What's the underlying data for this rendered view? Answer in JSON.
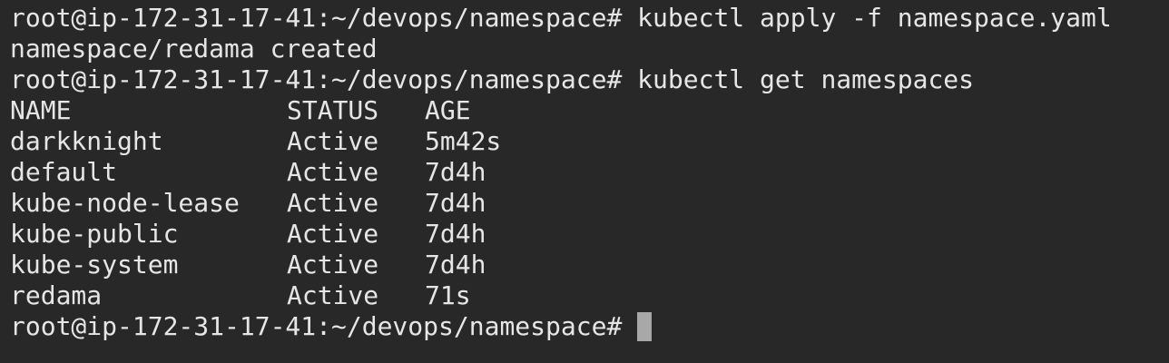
{
  "colors": {
    "background": "#282828",
    "text": "#e6e6e6",
    "cursor": "#a8a8a8"
  },
  "terminal": {
    "prompt": "root@ip-172-31-17-41:~/devops/namespace#",
    "cmd1": "kubectl apply -f namespace.yaml",
    "out1": "namespace/redama created",
    "cmd2": "kubectl get namespaces",
    "table": {
      "headers": [
        "NAME",
        "STATUS",
        "AGE"
      ],
      "rows": [
        [
          "darkknight",
          "Active",
          "5m42s"
        ],
        [
          "default",
          "Active",
          "7d4h"
        ],
        [
          "kube-node-lease",
          "Active",
          "7d4h"
        ],
        [
          "kube-public",
          "Active",
          "7d4h"
        ],
        [
          "kube-system",
          "Active",
          "7d4h"
        ],
        [
          "redama",
          "Active",
          "71s"
        ]
      ]
    }
  }
}
